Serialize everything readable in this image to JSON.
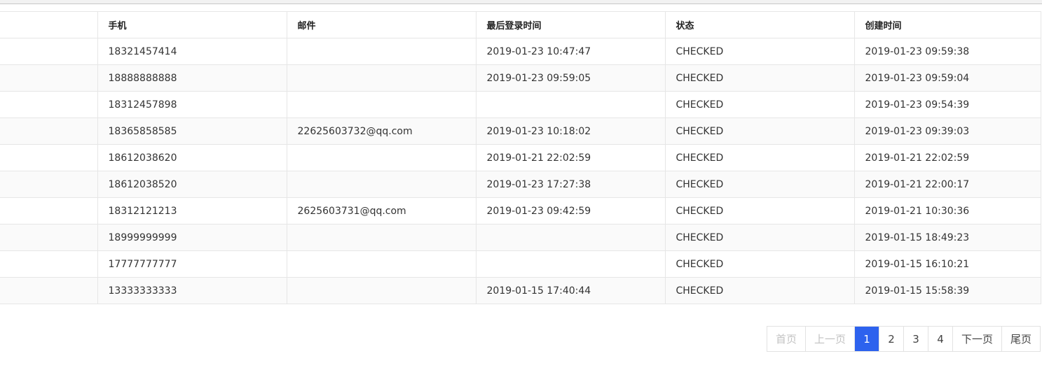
{
  "table": {
    "headers": [
      "",
      "手机",
      "邮件",
      "最后登录时间",
      "状态",
      "创建时间"
    ],
    "rows": [
      {
        "phone": "18321457414",
        "email": "",
        "last_login": "2019-01-23 10:47:47",
        "status": "CHECKED",
        "created": "2019-01-23 09:59:38"
      },
      {
        "phone": "18888888888",
        "email": "",
        "last_login": "2019-01-23 09:59:05",
        "status": "CHECKED",
        "created": "2019-01-23 09:59:04"
      },
      {
        "phone": "18312457898",
        "email": "",
        "last_login": "",
        "status": "CHECKED",
        "created": "2019-01-23 09:54:39"
      },
      {
        "phone": "18365858585",
        "email": "22625603732@qq.com",
        "last_login": "2019-01-23 10:18:02",
        "status": "CHECKED",
        "created": "2019-01-23 09:39:03"
      },
      {
        "phone": "18612038620",
        "email": "",
        "last_login": "2019-01-21 22:02:59",
        "status": "CHECKED",
        "created": "2019-01-21 22:02:59"
      },
      {
        "phone": "18612038520",
        "email": "",
        "last_login": "2019-01-23 17:27:38",
        "status": "CHECKED",
        "created": "2019-01-21 22:00:17"
      },
      {
        "phone": "18312121213",
        "email": "2625603731@qq.com",
        "last_login": "2019-01-23 09:42:59",
        "status": "CHECKED",
        "created": "2019-01-21 10:30:36"
      },
      {
        "phone": "18999999999",
        "email": "",
        "last_login": "",
        "status": "CHECKED",
        "created": "2019-01-15 18:49:23"
      },
      {
        "phone": "17777777777",
        "email": "",
        "last_login": "",
        "status": "CHECKED",
        "created": "2019-01-15 16:10:21"
      },
      {
        "phone": "13333333333",
        "email": "",
        "last_login": "2019-01-15 17:40:44",
        "status": "CHECKED",
        "created": "2019-01-15 15:58:39"
      }
    ]
  },
  "pagination": {
    "first": "首页",
    "prev": "上一页",
    "pages": [
      "1",
      "2",
      "3",
      "4"
    ],
    "current": "1",
    "next": "下一页",
    "last": "尾页"
  }
}
